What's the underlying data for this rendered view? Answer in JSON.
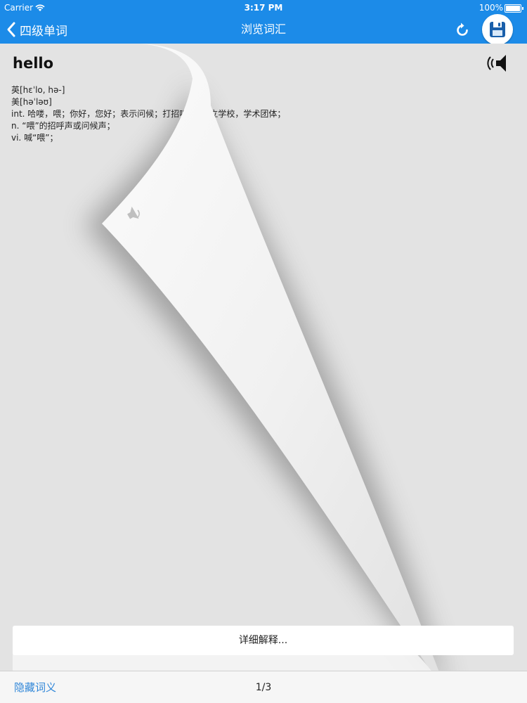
{
  "status_bar": {
    "carrier": "Carrier",
    "time": "3:17 PM",
    "battery": "100%"
  },
  "nav": {
    "back_label": "四级单词",
    "title": "浏览词汇",
    "refresh_icon": "refresh-icon",
    "save_icon": "floppy-disk-icon"
  },
  "word": {
    "headword": "hello",
    "pron_uk": "英[hɛˈlo, hə-]",
    "pron_us": "美[həˈləʊ]",
    "def_int": "int. 哈喽，喂；你好，您好；表示问候；打招呼 ... 私立学校，学术团体；",
    "def_n": "n. “喂”的招呼声或问候声；",
    "def_vi": "vi. 喊“喂”；"
  },
  "detail_button": "详细解释...",
  "toolbar": {
    "hide_label": "隐藏词义",
    "pager": "1/3"
  },
  "colors": {
    "accent": "#1c8be8",
    "link": "#2f86d8",
    "background": "#e3e3e3"
  }
}
